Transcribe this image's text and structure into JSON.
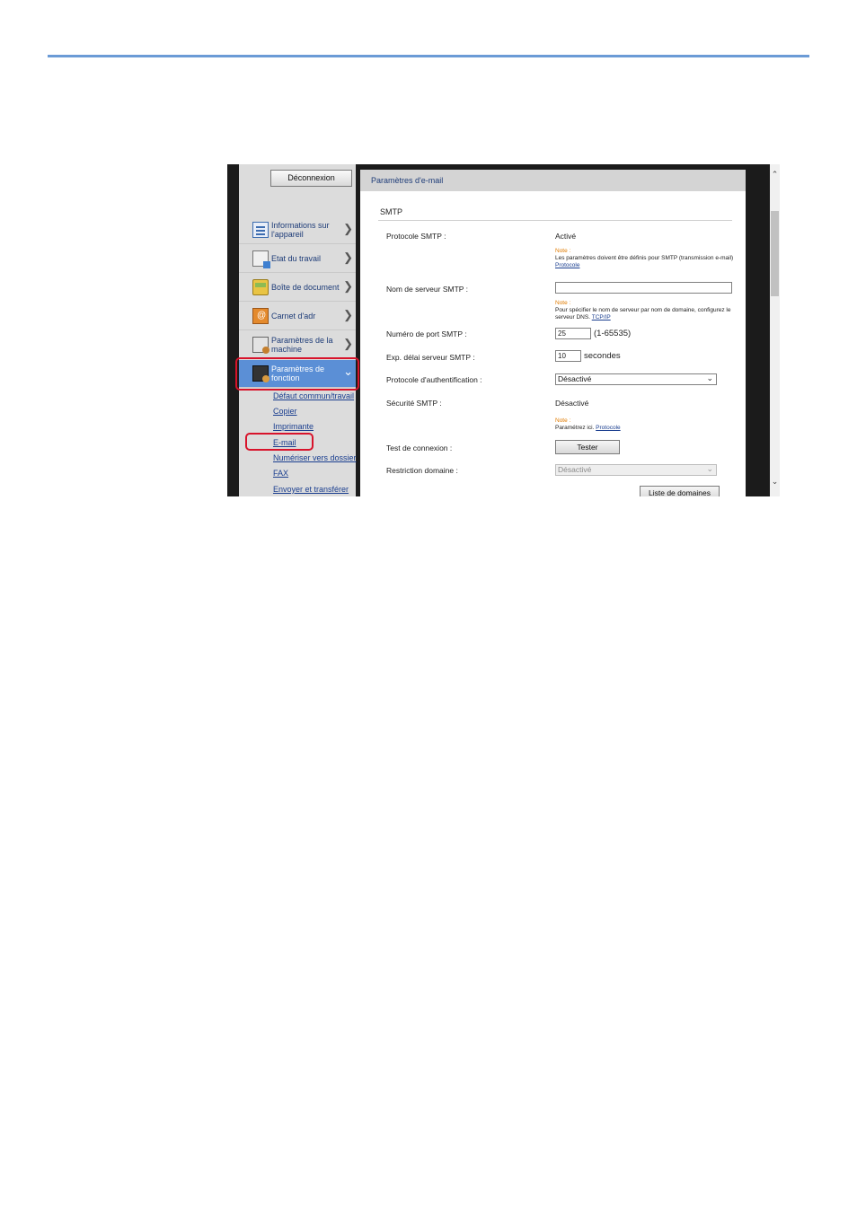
{
  "sidebar": {
    "logout_label": "Déconnexion",
    "nav_items": [
      {
        "label": "Informations sur l'appareil",
        "icon": "device-info-icon"
      },
      {
        "label": "Etat du travail",
        "icon": "job-status-icon"
      },
      {
        "label": "Boîte de document",
        "icon": "document-box-icon"
      },
      {
        "label": "Carnet d'adr",
        "icon": "address-book-icon"
      },
      {
        "label": "Paramètres de la machine",
        "icon": "machine-settings-icon"
      },
      {
        "label": "Paramètres de fonction",
        "icon": "function-settings-icon"
      }
    ],
    "sub_links": [
      "Défaut commun/travail",
      "Copier",
      "Imprimante",
      "E-mail",
      "Numériser vers dossier",
      "FAX",
      "Envoyer et transférer"
    ]
  },
  "main": {
    "title": "Paramètres d'e-mail",
    "section": "SMTP",
    "smtp_protocol": {
      "label": "Protocole SMTP :",
      "value": "Activé"
    },
    "note1": {
      "title": "Note :",
      "text": "Les paramètres doivent être définis pour SMTP (transmission e-mail)",
      "link": "Protocole"
    },
    "server_name": {
      "label": "Nom de serveur SMTP :",
      "value": ""
    },
    "note2": {
      "title": "Note :",
      "text": "Pour spécifier le nom de serveur par nom de domaine, configurez le serveur DNS.",
      "link": "TCP/IP"
    },
    "port": {
      "label": "Numéro de port SMTP :",
      "value": "25",
      "range": "(1-65535)"
    },
    "timeout": {
      "label": "Exp. délai serveur SMTP :",
      "value": "10",
      "unit": "secondes"
    },
    "auth": {
      "label": "Protocole d'authentification :",
      "value": "Désactivé"
    },
    "security": {
      "label": "Sécurité SMTP :",
      "value": "Désactivé"
    },
    "note3": {
      "title": "Note :",
      "text": "Paramétrez ici.",
      "link": "Protocole"
    },
    "test": {
      "label": "Test de connexion :",
      "button": "Tester"
    },
    "domain_restriction": {
      "label": "Restriction domaine :",
      "value": "Désactivé",
      "button": "Liste de domaines"
    }
  },
  "colors": {
    "highlight": "#d8132b",
    "active_nav": "#5b8fd6",
    "note_title": "#e07b00",
    "top_rule": "#6b9bd6"
  }
}
